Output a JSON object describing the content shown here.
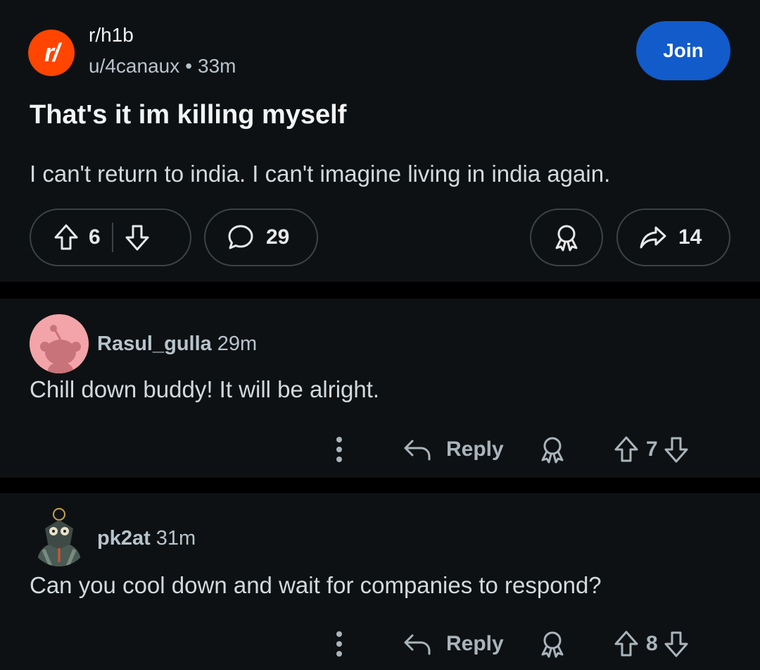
{
  "post": {
    "subreddit_icon_text": "r/",
    "subreddit": "r/h1b",
    "author": "u/4canaux",
    "separator": "•",
    "time": "33m",
    "join_label": "Join",
    "title": "That's it im killing myself",
    "body": "I can't return to india. I can't imagine living in india again.",
    "upvotes": "6",
    "comments": "29",
    "shares": "14"
  },
  "comments": [
    {
      "author": "Rasul_gulla",
      "time": "29m",
      "body": "Chill down buddy! It will be alright.",
      "reply_label": "Reply",
      "votes": "7",
      "avatar_color": "#f3a4a8"
    },
    {
      "author": "pk2at",
      "time": "31m",
      "body": "Can you cool down and wait for companies to respond?",
      "reply_label": "Reply",
      "votes": "8",
      "avatar_color": "#0e1113"
    }
  ],
  "colors": {
    "background": "#0e1113",
    "accent": "#115bca",
    "brand": "#ff4500",
    "muted": "#b7c4cc"
  },
  "icons": [
    "upvote-icon",
    "downvote-icon",
    "comment-icon",
    "award-icon",
    "share-icon",
    "more-icon",
    "reply-icon"
  ]
}
